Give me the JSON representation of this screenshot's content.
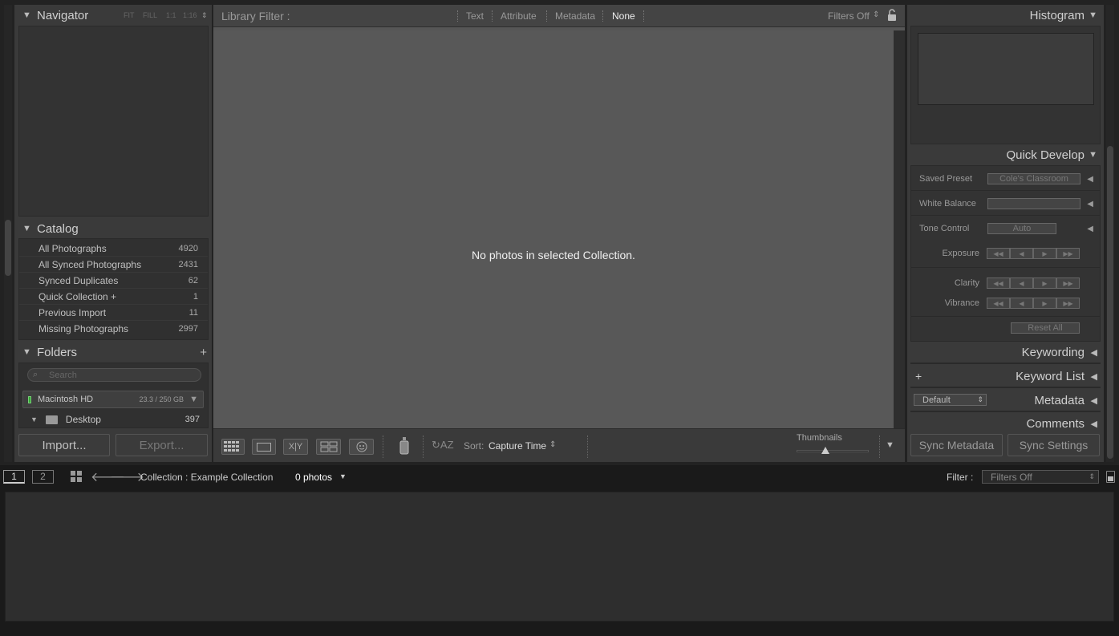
{
  "navigator": {
    "title": "Navigator",
    "zoom_fit": "FIT",
    "zoom_fill": "FILL",
    "zoom_1to1": "1:1",
    "zoom_custom": "1:16"
  },
  "catalog": {
    "title": "Catalog",
    "items": [
      {
        "label": "All Photographs",
        "count": "4920"
      },
      {
        "label": "All Synced Photographs",
        "count": "2431"
      },
      {
        "label": "Synced Duplicates",
        "count": "62"
      },
      {
        "label": "Quick Collection  +",
        "count": "1"
      },
      {
        "label": "Previous Import",
        "count": "11"
      },
      {
        "label": "Missing Photographs",
        "count": "2997"
      }
    ]
  },
  "folders": {
    "title": "Folders",
    "search_placeholder": "Search",
    "drive_name": "Macintosh HD",
    "drive_usage": "23.3 / 250 GB",
    "folder_name": "Desktop",
    "folder_count": "397"
  },
  "left_buttons": {
    "import": "Import...",
    "export": "Export..."
  },
  "library_filter": {
    "label": "Library Filter :",
    "tabs": [
      "Text",
      "Attribute",
      "Metadata",
      "None"
    ],
    "filters_status": "Filters Off"
  },
  "grid": {
    "empty_message": "No photos in selected Collection."
  },
  "toolbar": {
    "sort_label": "Sort:",
    "sort_value": "Capture Time",
    "thumbnails_label": "Thumbnails"
  },
  "right_panel": {
    "histogram_title": "Histogram",
    "quick_develop_title": "Quick Develop",
    "saved_preset_label": "Saved Preset",
    "saved_preset_value": "Cole's Classroom",
    "white_balance_label": "White Balance",
    "white_balance_value": "",
    "tone_control_label": "Tone Control",
    "auto_label": "Auto",
    "exposure_label": "Exposure",
    "clarity_label": "Clarity",
    "vibrance_label": "Vibrance",
    "reset_all_label": "Reset All",
    "keywording_title": "Keywording",
    "keyword_list_title": "Keyword List",
    "metadata_preset": "Default",
    "metadata_title": "Metadata",
    "comments_title": "Comments",
    "sync_metadata": "Sync Metadata",
    "sync_settings": "Sync Settings"
  },
  "filmstrip": {
    "screen1": "1",
    "screen2": "2",
    "source": "Collection : Example Collection",
    "photo_count": "0 photos",
    "filter_label": "Filter :",
    "filter_value": "Filters Off"
  }
}
